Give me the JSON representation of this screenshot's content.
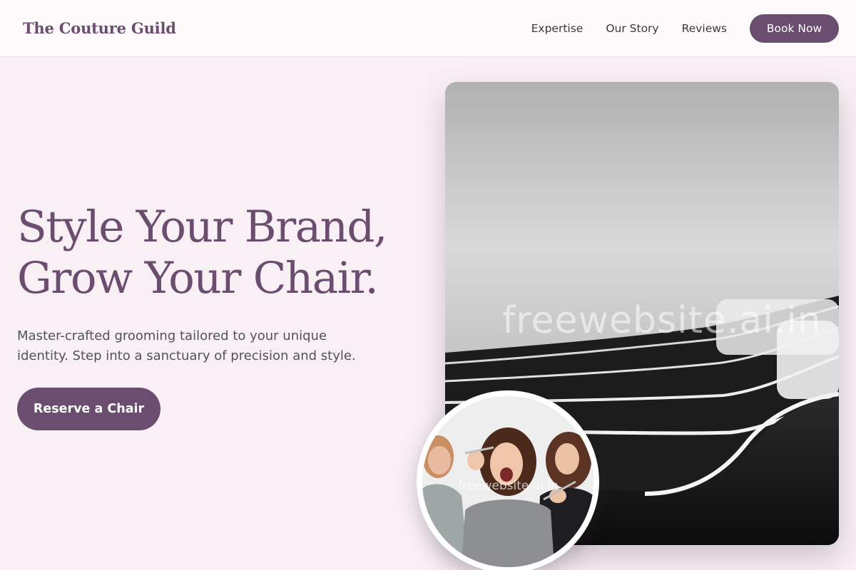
{
  "header": {
    "brand": "The Couture Guild",
    "nav": [
      {
        "label": "Expertise"
      },
      {
        "label": "Our Story"
      },
      {
        "label": "Reviews"
      }
    ],
    "cta_label": "Book Now"
  },
  "hero": {
    "headline_line1": "Style Your Brand,",
    "headline_line2": "Grow Your Chair.",
    "subtext": "Master-crafted grooming tailored to your unique identity. Step into a sanctuary of precision and style.",
    "cta_label": "Reserve a Chair"
  },
  "images": {
    "main_watermark": "freewebsite.ai.in",
    "team_watermark": "freewebsite.ai.in"
  },
  "colors": {
    "accent": "#6b4d6f",
    "background": "#f8f0f5",
    "text_body": "#4f535a"
  }
}
